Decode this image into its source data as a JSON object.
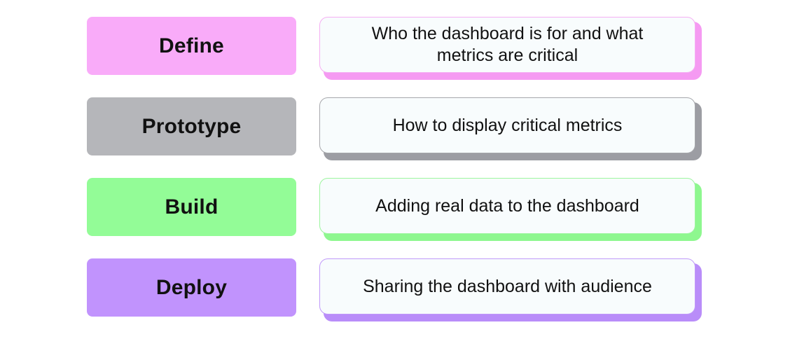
{
  "steps": [
    {
      "label": "Define",
      "description": "Who the dashboard is for and what metrics are critical",
      "label_color": "#f9abf9",
      "accent_color": "#f59af2",
      "border_color": "#f5aef3"
    },
    {
      "label": "Prototype",
      "description": "How to display critical metrics",
      "label_color": "#b5b6ba",
      "accent_color": "#9c9da3",
      "border_color": "#a6a7ab"
    },
    {
      "label": "Build",
      "description": "Adding real data to the dashboard",
      "label_color": "#93fc97",
      "accent_color": "#8ef78f",
      "border_color": "#9cf59e"
    },
    {
      "label": "Deploy",
      "description": "Sharing the dashboard with audience",
      "label_color": "#c193fd",
      "accent_color": "#b98df9",
      "border_color": "#c099fa"
    }
  ]
}
